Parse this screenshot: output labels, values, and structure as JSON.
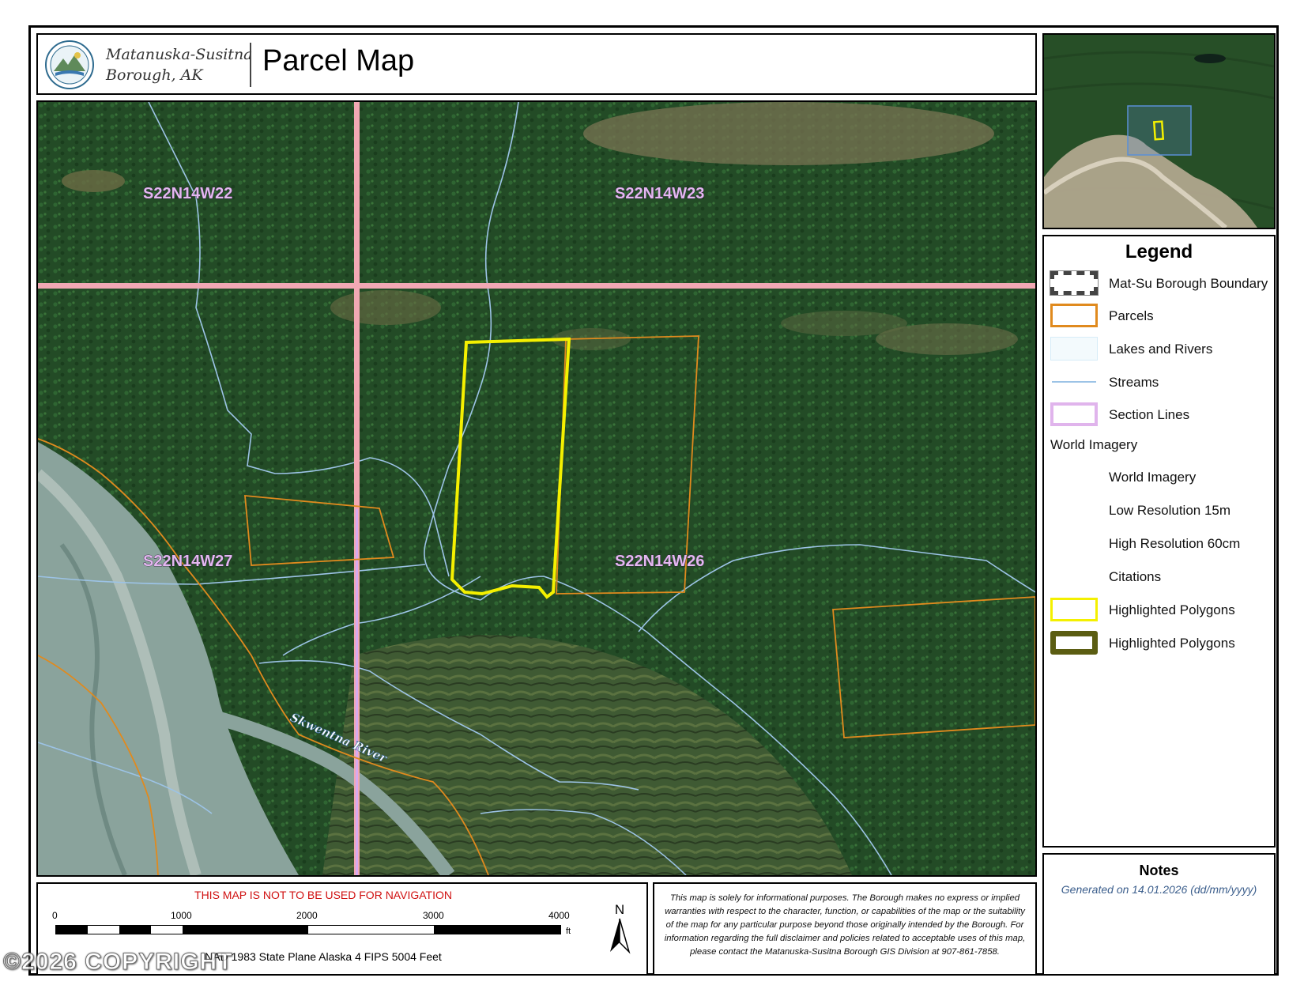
{
  "header": {
    "org_line1": "Matanuska-Susitna",
    "org_line2": "Borough, AK",
    "title": "Parcel Map"
  },
  "map": {
    "section_labels": [
      "S22N14W22",
      "S22N14W23",
      "S22N14W27",
      "S22N14W26"
    ],
    "river_label": "Skwentna River",
    "colors": {
      "forest": "#244d27",
      "river_bed": "#8aa39c",
      "parcel_line": "#e08a1e",
      "section_line": "#f2a8b4",
      "stream": "#9cc3e6",
      "highlight": "#f4f000"
    }
  },
  "legend": {
    "title": "Legend",
    "items": [
      {
        "label": "Mat-Su Borough Boundary",
        "icon": "borough-boundary-swatch"
      },
      {
        "label": "Parcels",
        "icon": "parcels-swatch"
      },
      {
        "label": "Lakes and Rivers",
        "icon": "lakes-rivers-swatch"
      },
      {
        "label": "Streams",
        "icon": "streams-swatch"
      },
      {
        "label": "Section Lines",
        "icon": "section-lines-swatch"
      }
    ],
    "group_label": "World Imagery",
    "group_items": [
      "World Imagery",
      "Low Resolution 15m",
      "High Resolution 60cm",
      "Citations"
    ],
    "highlight_items": [
      {
        "label": "Highlighted Polygons",
        "icon": "highlight-yellow-swatch"
      },
      {
        "label": "Highlighted Polygons",
        "icon": "highlight-olive-swatch"
      }
    ]
  },
  "notes": {
    "title": "Notes",
    "text": "Generated on  14.01.2026  (dd/mm/yyyy)"
  },
  "scale": {
    "warning": "THIS MAP IS NOT TO BE USED FOR NAVIGATION",
    "ticks": [
      "0",
      "1000",
      "2000",
      "3000",
      "4000"
    ],
    "unit": "ft",
    "north": "N",
    "projection": "NAD 1983 State Plane Alaska 4 FIPS 5004 Feet"
  },
  "disclaimer": {
    "text": "This map is solely for informational purposes. The Borough makes no express or implied warranties with respect to the character, function, or capabilities of the map or the suitability of the map for any particular purpose beyond those originally intended by the Borough. For information regarding the full disclaimer and policies related to acceptable uses of this map, please contact the Matanuska-Susitna Borough GIS Division at 907-861-7858."
  },
  "watermark": "©2026 COPYRIGHT"
}
